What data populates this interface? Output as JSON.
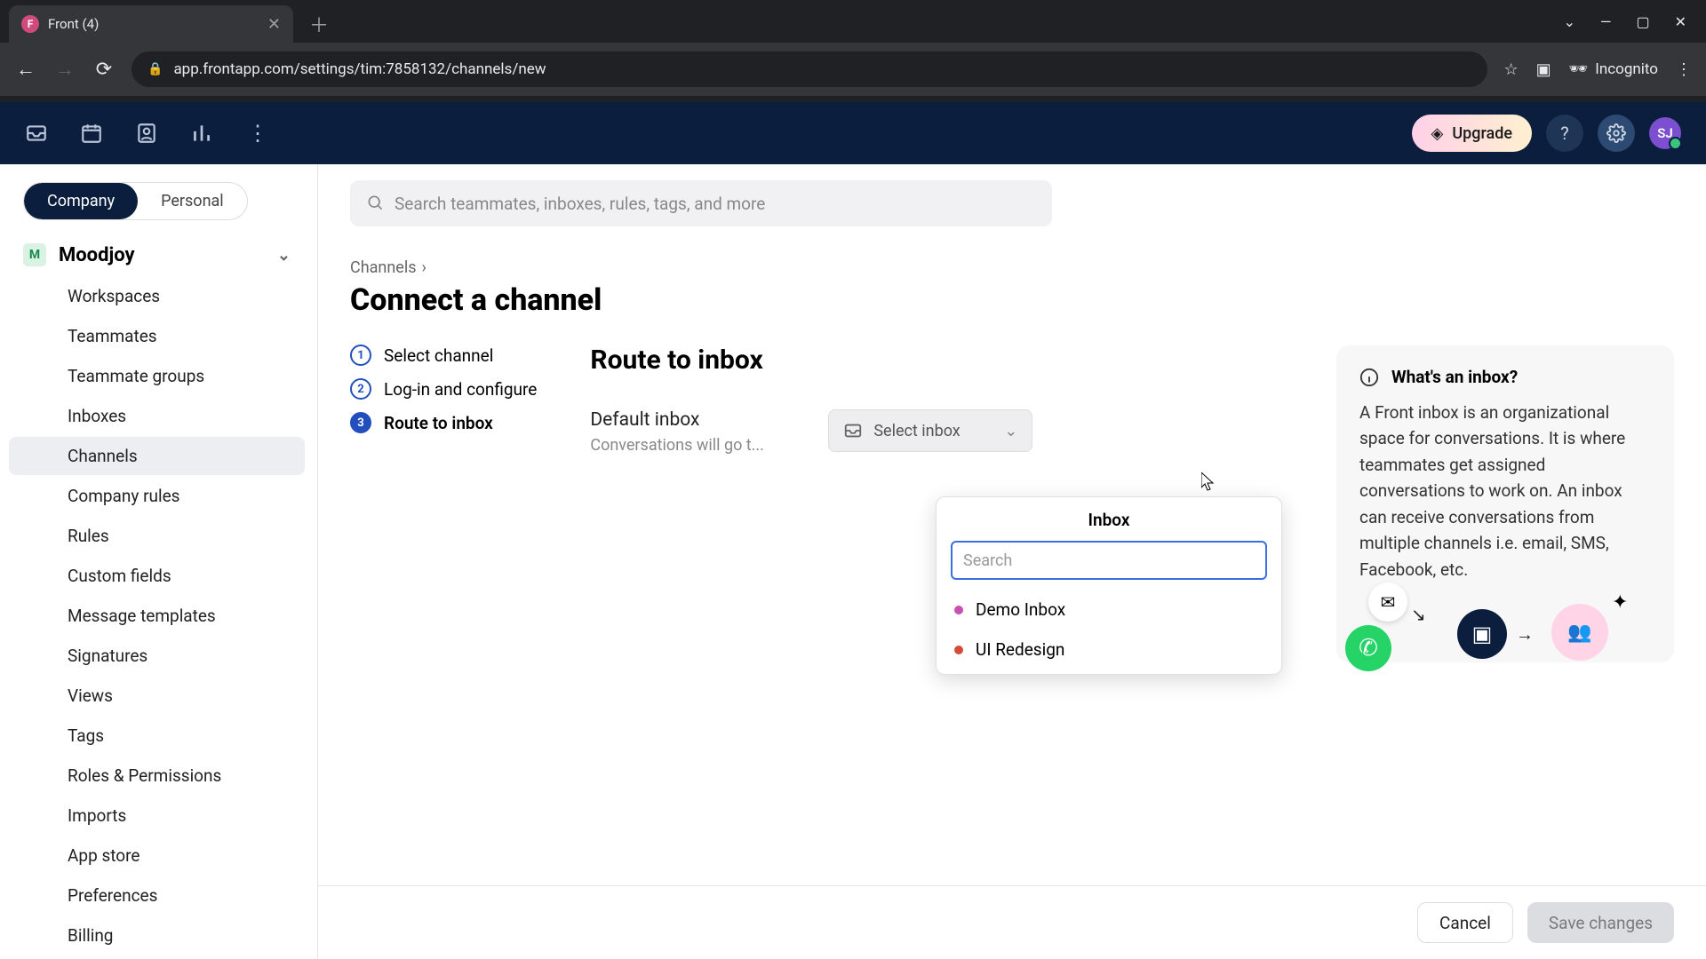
{
  "browser": {
    "tab_title": "Front (4)",
    "url": "app.frontapp.com/settings/tim:7858132/channels/new",
    "incognito_label": "Incognito"
  },
  "topbar": {
    "upgrade_label": "Upgrade",
    "avatar_initials": "SJ"
  },
  "sidebar": {
    "scope": {
      "company": "Company",
      "personal": "Personal"
    },
    "org_name": "Moodjoy",
    "org_initial": "M",
    "items": [
      "Workspaces",
      "Teammates",
      "Teammate groups",
      "Inboxes",
      "Channels",
      "Company rules",
      "Rules",
      "Custom fields",
      "Message templates",
      "Signatures",
      "Views",
      "Tags",
      "Roles & Permissions",
      "Imports",
      "App store",
      "Preferences",
      "Billing"
    ],
    "active_index": 4
  },
  "search": {
    "placeholder": "Search teammates, inboxes, rules, tags, and more"
  },
  "breadcrumb": {
    "parent": "Channels"
  },
  "page": {
    "title": "Connect a channel"
  },
  "steps": [
    {
      "label": "Select channel"
    },
    {
      "label": "Log-in and configure"
    },
    {
      "label": "Route to inbox"
    }
  ],
  "current_step": 2,
  "route": {
    "heading": "Route to inbox",
    "field_label": "Default inbox",
    "field_sub": "Conversations will go t...",
    "select_label": "Select inbox"
  },
  "dropdown": {
    "title": "Inbox",
    "search_placeholder": "Search",
    "options": [
      {
        "label": "Demo Inbox",
        "color": "#c94fb0"
      },
      {
        "label": "UI Redesign",
        "color": "#d34a3a"
      }
    ]
  },
  "info": {
    "title": "What's an inbox?",
    "body": "A Front inbox is an organizational space for conversations. It is where teammates get assigned conversations to work on. An inbox can receive conversations from multiple channels i.e. email, SMS, Facebook, etc."
  },
  "footer": {
    "cancel": "Cancel",
    "save": "Save changes"
  }
}
